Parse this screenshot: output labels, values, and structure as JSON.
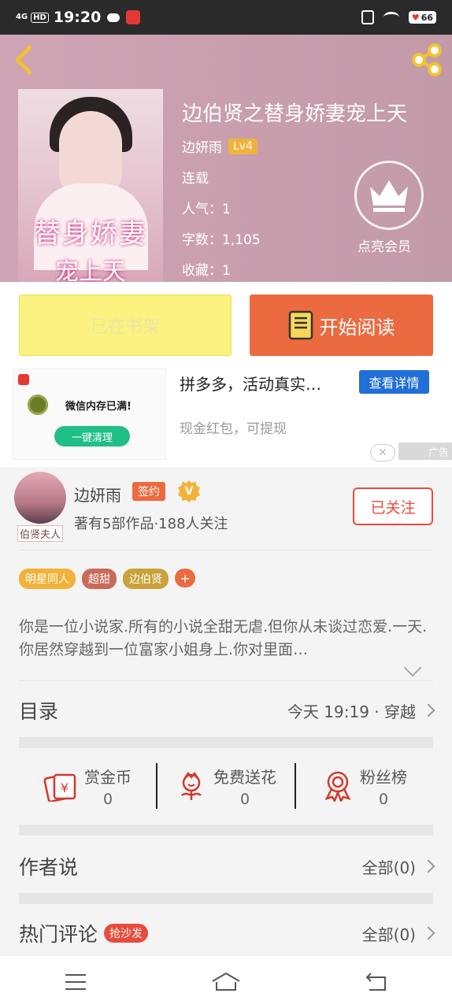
{
  "status_bar": {
    "network": "4G",
    "hd": "HD",
    "time": "19:20",
    "battery": "66"
  },
  "book": {
    "title": "边伯贤之替身娇妻宠上天",
    "author": "边妍雨",
    "level": "Lv4",
    "status": "连载",
    "popularity": "人气：1",
    "word_count": "字数：1,105",
    "favorites": "收藏：1",
    "cover_title_1": "替身娇妻",
    "cover_title_2": "宠上天",
    "vip_label": "点亮会员"
  },
  "actions": {
    "shelf_label": "已在书架",
    "read_label": "开始阅读"
  },
  "ad": {
    "image_message": "微信内存已满!",
    "image_button": "一键清理",
    "title": "拼多多，活动真实…",
    "detail_button": "查看详情",
    "subtitle": "现金红包，可提现",
    "tag": "广告",
    "close": "✕"
  },
  "author_section": {
    "name": "边妍雨",
    "sign_badge": "签约",
    "v_badge": "V",
    "stats": "著有5部作品·188人关注",
    "avatar_tag": "伯贤夫人",
    "follow_label": "已关注"
  },
  "tags": [
    {
      "label": "明星同人",
      "color": "#f2b23a"
    },
    {
      "label": "超甜",
      "color": "#c96a5a"
    },
    {
      "label": "边伯贤",
      "color": "#c9a23a"
    }
  ],
  "tag_add": "+",
  "intro": "你是一位小说家.所有的小说全甜无虐.但你从未谈过恋爱.一天.你居然穿越到一位富家小姐身上.你对里面…",
  "toc": {
    "label": "目录",
    "latest": "今天 19:19 · 穿越"
  },
  "gifts": [
    {
      "name": "赏金币",
      "count": "0",
      "icon": "coin-envelope-icon"
    },
    {
      "name": "免费送花",
      "count": "0",
      "icon": "flower-icon"
    },
    {
      "name": "粉丝榜",
      "count": "0",
      "icon": "medal-icon"
    }
  ],
  "author_says": {
    "label": "作者说",
    "right": "全部(0)"
  },
  "hot_comments": {
    "label": "热门评论",
    "badge": "抢沙发",
    "right": "全部(0)"
  },
  "colors": {
    "accent_orange": "#ec6a3f",
    "follow_red": "#e84b3c",
    "shelf_yellow": "#fbf27f",
    "ad_blue": "#1f6fd6"
  }
}
